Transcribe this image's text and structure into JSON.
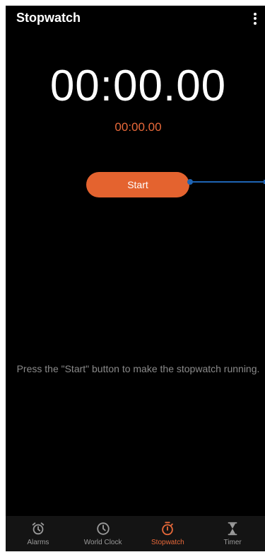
{
  "app_bar": {
    "title": "Stopwatch",
    "menu_icon": "more-vert-icon"
  },
  "stopwatch": {
    "main_time": "00:00.00",
    "lap_time": "00:00.00",
    "start_label": "Start",
    "hint": "Press the \"Start\" button to make the stopwatch running."
  },
  "bottom_nav": {
    "items": [
      {
        "label": "Alarms",
        "icon": "alarm-icon",
        "active": false
      },
      {
        "label": "World Clock",
        "icon": "clock-icon",
        "active": false
      },
      {
        "label": "Stopwatch",
        "icon": "stopwatch-icon",
        "active": true
      },
      {
        "label": "Timer",
        "icon": "hourglass-icon",
        "active": false
      }
    ]
  },
  "colors": {
    "background": "#000000",
    "accent": "#e4632f",
    "inactive_nav": "#9a9a9a",
    "hint_text": "#8a8a8a",
    "pointer": "#1e64b4"
  }
}
